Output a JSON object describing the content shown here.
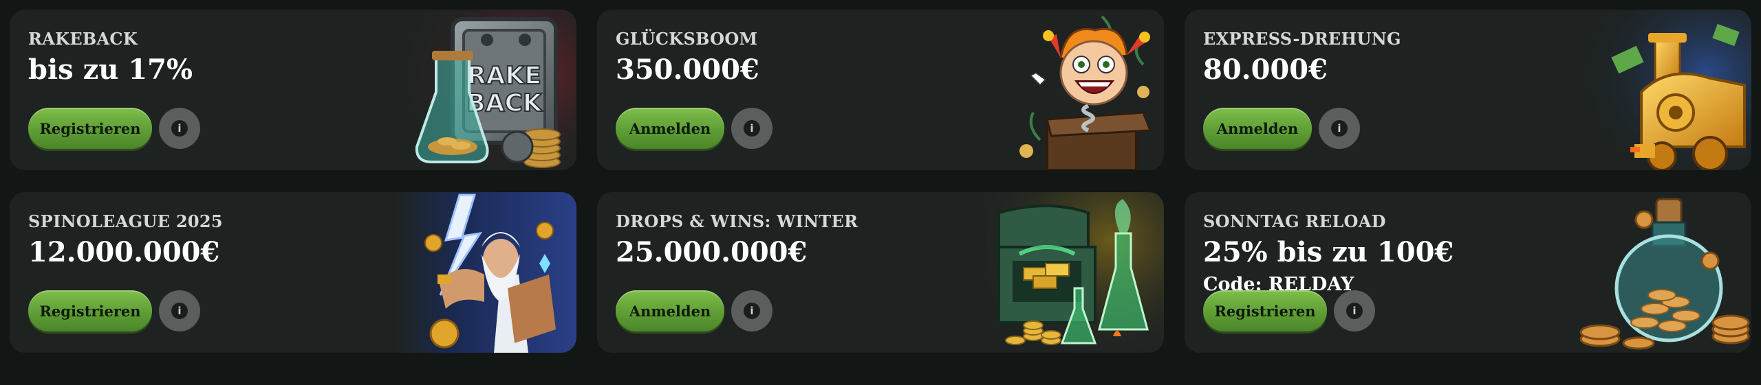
{
  "cards": [
    {
      "eyebrow": "RAKEBACK",
      "headline": "bis zu 17%",
      "button": "Registrieren",
      "info_icon": "info-icon",
      "art": "rakeback-safe-flask-coins"
    },
    {
      "eyebrow": "GLÜCKSBOOM",
      "headline": "350.000€",
      "button": "Anmelden",
      "info_icon": "info-icon",
      "art": "jester-jack-in-the-box"
    },
    {
      "eyebrow": "EXPRESS-DREHUNG",
      "headline": "80.000€",
      "button": "Anmelden",
      "info_icon": "info-icon",
      "art": "golden-locomotive-money"
    },
    {
      "eyebrow": "SPINOLEAGUE 2025",
      "headline": "12.000.000€",
      "button": "Registrieren",
      "info_icon": "info-icon",
      "art": "zeus-lightning"
    },
    {
      "eyebrow": "DROPS & WINS: WINTER",
      "headline": "25.000.000€",
      "button": "Anmelden",
      "info_icon": "info-icon",
      "art": "treasure-chest-potions"
    },
    {
      "eyebrow": "SONNTAG RELOAD",
      "headline": "25% bis zu 100€",
      "code": "Code: RELDAY",
      "button": "Registrieren",
      "info_icon": "info-icon",
      "art": "coin-potion-bottle"
    }
  ],
  "colors": {
    "page_bg": "#121614",
    "card_bg": "#1e2322",
    "button_green": "#5e9e35",
    "info_grey": "#5a5f5d"
  }
}
